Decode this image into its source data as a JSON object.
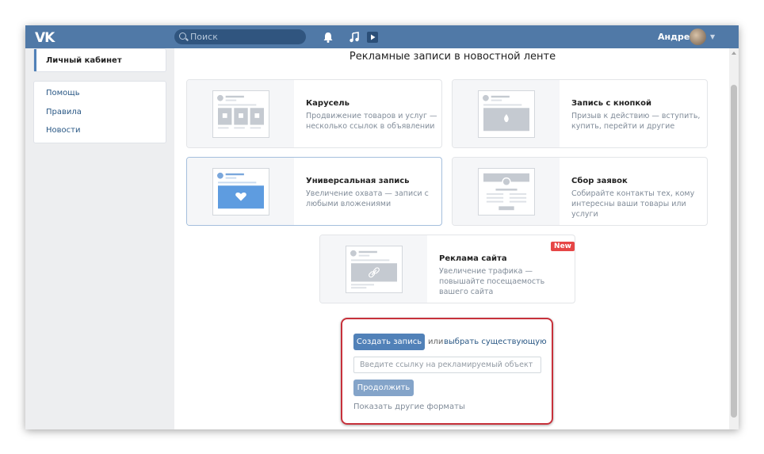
{
  "header": {
    "logo": "VK",
    "search_placeholder": "Поиск",
    "user_name": "Андрей"
  },
  "sidebar": {
    "active_item": "Личный кабинет",
    "links": [
      "Помощь",
      "Правила",
      "Новости"
    ]
  },
  "main": {
    "title": "Рекламные записи в новостной ленте",
    "formats": [
      {
        "title": "Карусель",
        "description": "Продвижение товаров и услуг — несколько ссылок в объявлении",
        "icon": "carousel-thumb-icon"
      },
      {
        "title": "Запись с кнопкой",
        "description": "Призыв к действию — вступить, купить, перейти и другие",
        "icon": "button-post-thumb-icon"
      },
      {
        "title": "Универсальная запись",
        "description": "Увеличение охвата — записи с любыми вложениями",
        "icon": "universal-post-thumb-icon"
      },
      {
        "title": "Сбор заявок",
        "description": "Собирайте контакты тех, кому интересны ваши товары или услуги",
        "icon": "lead-form-thumb-icon"
      },
      {
        "title": "Реклама сайта",
        "description": "Увеличение трафика — повышайте посещаемость вашего сайта",
        "icon": "site-ad-thumb-icon",
        "badge": "New"
      }
    ],
    "create_button": "Создать запись",
    "or_text": "или",
    "choose_existing": "выбрать существующую",
    "link_placeholder": "Введите ссылку на рекламируемый объект",
    "continue_button": "Продолжить",
    "other_formats": "Показать другие форматы"
  },
  "colors": {
    "header_bg": "#5079a7",
    "accent": "#5181b8",
    "highlight_border": "#c7313b",
    "new_badge": "#e64646"
  }
}
